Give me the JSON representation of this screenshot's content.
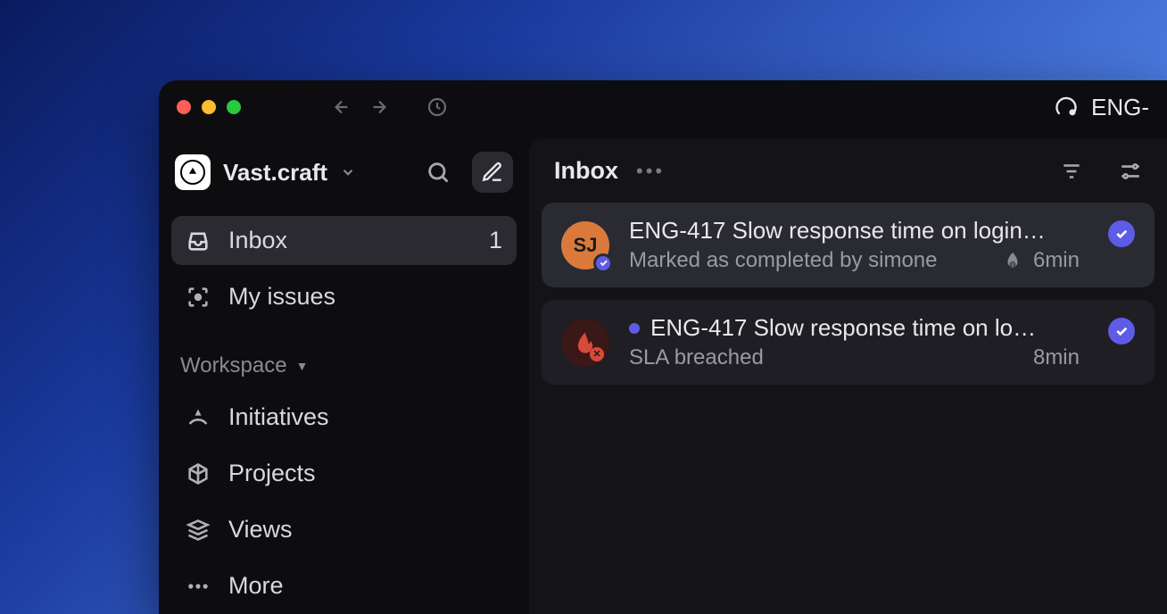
{
  "workspace": {
    "name": "Vast.craft"
  },
  "breadcrumb": {
    "label": "ENG-"
  },
  "sidebar": {
    "inbox": {
      "label": "Inbox",
      "count": "1"
    },
    "my_issues": {
      "label": "My issues"
    },
    "section_label": "Workspace",
    "initiatives": {
      "label": "Initiatives"
    },
    "projects": {
      "label": "Projects"
    },
    "views": {
      "label": "Views"
    },
    "more": {
      "label": "More"
    }
  },
  "main": {
    "title": "Inbox"
  },
  "inbox": [
    {
      "avatar_initials": "SJ",
      "title": "ENG-417 Slow response time on login…",
      "subtitle": "Marked as completed by simone",
      "time": "6min",
      "has_sla_icon": true,
      "unread": false
    },
    {
      "title": "ENG-417 Slow response time on lo…",
      "subtitle": "SLA breached",
      "time": "8min",
      "has_sla_icon": false,
      "unread": true
    }
  ]
}
